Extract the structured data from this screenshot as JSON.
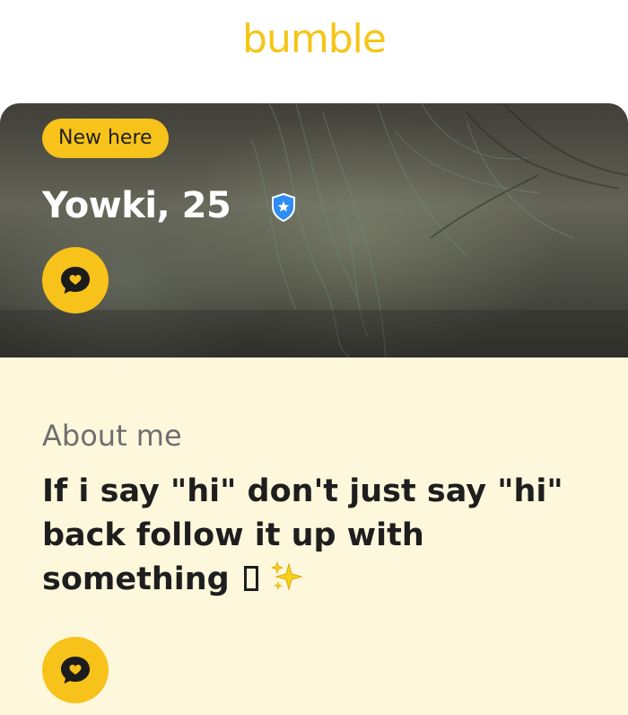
{
  "app": {
    "logo_text": "bumble",
    "brand_color": "#f5c518"
  },
  "profile": {
    "badge_label": "New here",
    "name_age": "Yowki, 25",
    "verified_icon": "verified-shield-icon",
    "chat_icon": "chat-heart-icon"
  },
  "about": {
    "label": "About me",
    "text": "If i say \"hi\" don't just say \"hi\" back follow it up with something",
    "trailing_glyph": "□",
    "trailing_emoji_icon": "sparkles-icon"
  },
  "colors": {
    "accent": "#f7c21a",
    "card_background": "#fdf7dc",
    "verified_blue": "#2f8cf2"
  }
}
